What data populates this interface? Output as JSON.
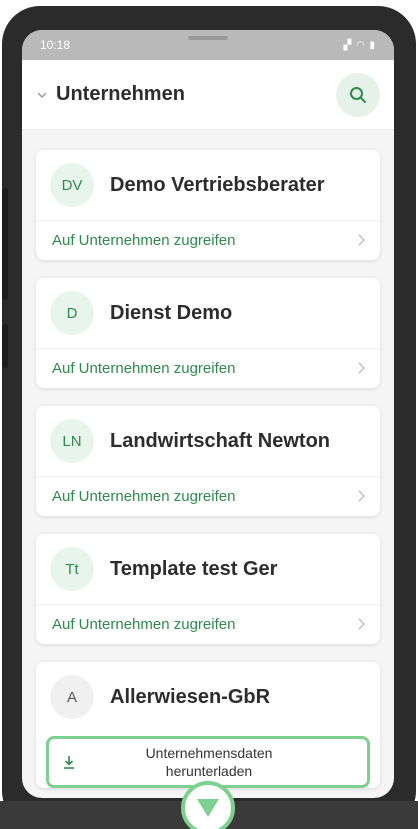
{
  "status_bar": {
    "time": "10:18",
    "icons": "▞ ◠ ▮"
  },
  "header": {
    "title": "Unternehmen",
    "search_icon": "search-icon"
  },
  "companies": [
    {
      "initials": "DV",
      "name": "Demo Vertriebsberater",
      "action": "Auf Unternehmen zugreifen"
    },
    {
      "initials": "D",
      "name": "Dienst Demo",
      "action": "Auf Unternehmen zugreifen"
    },
    {
      "initials": "LN",
      "name": "Landwirtschaft Newton",
      "action": "Auf Unternehmen zugreifen"
    },
    {
      "initials": "Tt",
      "name": "Template test Ger",
      "action": "Auf Unternehmen zugreifen"
    }
  ],
  "last_company": {
    "initials": "A",
    "name": "Allerwiesen-GbR",
    "download_label_line1": "Unternehmensdaten",
    "download_label_line2": "herunterladen"
  },
  "colors": {
    "accent": "#2e8b4e",
    "highlight": "#7ed08f"
  }
}
